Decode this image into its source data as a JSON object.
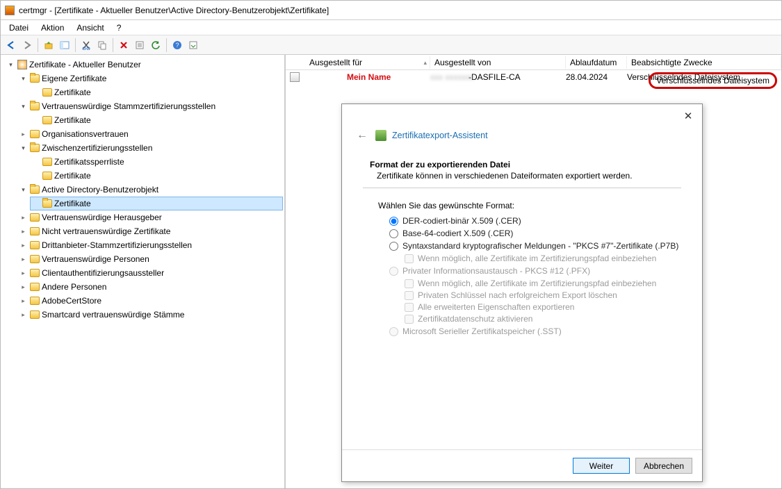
{
  "title": "certmgr - [Zertifikate - Aktueller Benutzer\\Active Directory-Benutzerobjekt\\Zertifikate]",
  "menu": {
    "file": "Datei",
    "action": "Aktion",
    "view": "Ansicht",
    "help": "?"
  },
  "toolbar_icons": {
    "back": "back-arrow",
    "fwd": "forward-arrow",
    "up": "up-folder",
    "props": "properties",
    "cut": "cut",
    "copy": "copy",
    "delete": "delete-x",
    "refresh": "refresh",
    "export": "export-list",
    "help2": "help",
    "media": "media"
  },
  "tree": {
    "root": "Zertifikate - Aktueller Benutzer",
    "eigene": "Eigene Zertifikate",
    "eigene_sub": "Zertifikate",
    "vert_stamm": "Vertrauenswürdige Stammzertifizierungsstellen",
    "vert_stamm_sub": "Zertifikate",
    "org": "Organisationsvertrauen",
    "zwischen": "Zwischenzertifizierungsstellen",
    "zwischen_sperr": "Zertifikatssperrliste",
    "zwischen_cert": "Zertifikate",
    "ad": "Active Directory-Benutzerobjekt",
    "ad_sub": "Zertifikate",
    "vert_hg": "Vertrauenswürdige Herausgeber",
    "nicht_vert": "Nicht vertrauenswürdige Zertifikate",
    "dritt": "Drittanbieter-Stammzertifizierungsstellen",
    "vert_pers": "Vertrauenswürdige Personen",
    "client_auth": "Clientauthentifizierungsaussteller",
    "andere": "Andere Personen",
    "adobe": "AdobeCertStore",
    "smartcard": "Smartcard vertrauenswürdige Stämme"
  },
  "list": {
    "head_ausfuer": "Ausgestellt für",
    "head_ausvon": "Ausgestellt von",
    "head_ablauf": "Ablaufdatum",
    "head_zweck": "Beabsichtigte Zwecke",
    "row_name": "Mein Name",
    "row_von_mask": "-DASFILE-CA",
    "row_ablauf": "28.04.2024",
    "row_zweck": "Verschlüsselndes Dateisystem"
  },
  "dialog": {
    "title": "Zertifikatexport-Assistent",
    "sect_head": "Format der zu exportierenden Datei",
    "sect_sub": "Zertifikate können in verschiedenen Dateiformaten exportiert werden.",
    "prompt": "Wählen Sie das gewünschte Format:",
    "opt_der": "DER-codiert-binär X.509 (.CER)",
    "opt_b64": "Base-64-codiert X.509 (.CER)",
    "opt_p7b": "Syntaxstandard kryptografischer Meldungen - \"PKCS #7\"-Zertifikate (.P7B)",
    "sub_p7b_1": "Wenn möglich, alle Zertifikate im Zertifizierungspfad einbeziehen",
    "opt_pfx": "Privater Informationsaustausch - PKCS #12 (.PFX)",
    "sub_pfx_1": "Wenn möglich, alle Zertifikate im Zertifizierungspfad einbeziehen",
    "sub_pfx_2": "Privaten Schlüssel nach erfolgreichem Export löschen",
    "sub_pfx_3": "Alle erweiterten Eigenschaften exportieren",
    "sub_pfx_4": "Zertifikatdatenschutz aktivieren",
    "opt_sst": "Microsoft Serieller Zertifikatspeicher (.SST)",
    "btn_next": "Weiter",
    "btn_cancel": "Abbrechen"
  }
}
